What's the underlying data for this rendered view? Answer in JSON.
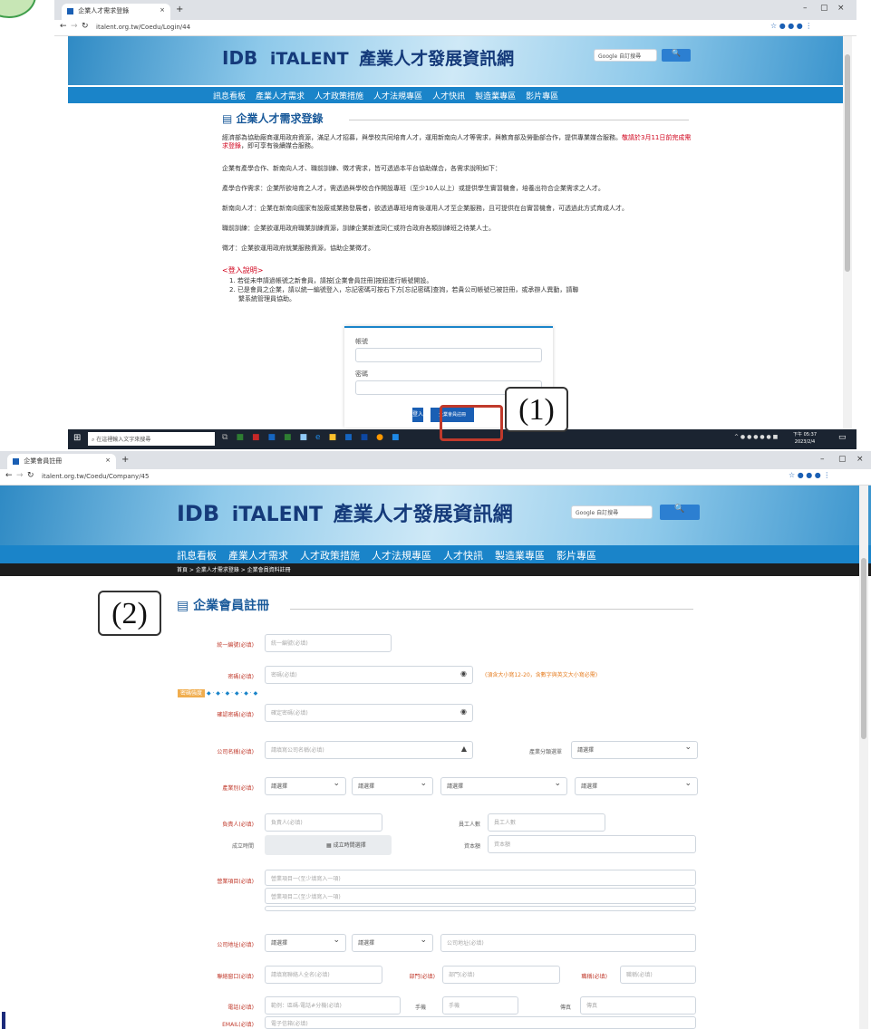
{
  "browser1": {
    "tab_title": "企業人才需求登錄",
    "url": "italent.org.tw/Coedu/Login/44"
  },
  "browser2": {
    "tab_title": "企業會員註冊",
    "url": "italent.org.tw/Coedu/Company/45"
  },
  "site": {
    "brand": "iTALENT",
    "title": "產業人才發展資訊網",
    "search_placeholder": "Google 自訂搜尋",
    "nav": [
      "訊息看板",
      "產業人才需求",
      "人才政策措施",
      "人才法規專區",
      "人才快訊",
      "製造業專區",
      "影片專區"
    ],
    "breadcrumb": "首頁 > 企業人才需求登錄 > 企業會員資料註冊"
  },
  "login_page": {
    "heading": "企業人才需求登錄",
    "paragraphs": [
      "經濟部為協助廠商運用政府資源，滿足人才招募，與學校共同培育人才，運用新南向人才等需求，與教育部及勞動部合作，提供專業媒合服務。",
      "敬請於3月11日前完成需求登錄",
      "，即可享有後續媒合服務。",
      "企業有產學合作、新南向人才、職前訓練、徵才需求，皆可透過本平台協助媒合，各需求說明如下：",
      "產學合作需求：企業所欲培育之人才，需透過與學校合作開設專班（至少10人以上）或提供學生實習機會，培養出符合企業需求之人才。",
      "新南向人才：企業在新南向國家有設廠或業務發展者，欲透過專班培育後運用人才至企業服務，且可提供在台實習機會，可透過此方式育成人才。",
      "職前訓練：企業欲運用政府職業訓練資源，訓練企業新進同仁或符合政府各類訓練班之待業人士。",
      "徵才：企業欲運用政府就業服務資源，協助企業徵才。"
    ],
    "login_note_title": "<登入說明>",
    "login_notes": [
      "1. 若從未申請過帳號之新會員，請按[企業會員註冊]按鈕進行帳號開設。",
      "2. 已是會員之企業，請以統一編號登入，忘記密碼可按右下方[忘記密碼]查詢，若貴公司帳號已被註冊，或承辦人異動，請聯",
      "繫系統管理員協助。"
    ],
    "account_label": "帳號",
    "password_label": "密碼",
    "login_button": "登入",
    "register_button": "企業會員註冊"
  },
  "register_page": {
    "heading": "企業會員註冊",
    "fields": {
      "tax_id": {
        "label": "統一編號(必填)",
        "placeholder": "統一編號(必填)"
      },
      "password": {
        "label": "密碼(必填)",
        "placeholder": "密碼(必填)",
        "hint": "(須含大小寫12-20，含數字與英文大小寫必需)"
      },
      "confirm_password": {
        "label": "確認密碼(必填)",
        "placeholder": "確定密碼(必填)"
      },
      "company_name": {
        "label": "公司名稱(必填)",
        "placeholder": "請填寫公司名稱(必填)"
      },
      "industry": {
        "label": "產業別(必填)"
      },
      "owner": {
        "label": "負責人(必填)",
        "placeholder": "負責人(必填)"
      },
      "employees": {
        "label": "員工人數",
        "placeholder": "員工人數"
      },
      "founded": {
        "label": "成立時間",
        "button": "成立時間選擇"
      },
      "capital": {
        "label": "資本額",
        "placeholder": "資本額"
      },
      "business": {
        "label": "營業項目(必填)",
        "placeholder1": "營業項目一(至少填寫入一項)",
        "placeholder2": "營業項目二(至少填寫入一項)"
      },
      "address": {
        "label": "公司地址(必填)",
        "placeholder": "公司地址(必填)"
      },
      "contact": {
        "label": "聯絡窗口(必填)",
        "placeholder": "請填寫聯絡人全名(必填)"
      },
      "department": {
        "label": "部門(必填)",
        "placeholder": "部門(必填)"
      },
      "title": {
        "label": "職稱(必填)",
        "placeholder": "職稱(必填)"
      },
      "phone": {
        "label": "電話(必填)",
        "placeholder": "範例：區碼-電話#分機(必填)"
      },
      "mobile": {
        "label": "手機",
        "placeholder": "手機"
      },
      "fax": {
        "label": "傳真",
        "placeholder": "傳真"
      },
      "email": {
        "label": "EMAIL(必填)",
        "placeholder": "電子信箱(必填)"
      }
    },
    "select_default": "請選擇",
    "select_label_side": "產業分類選單",
    "strength_label": "密碼強度"
  },
  "taskbar": {
    "search_placeholder": "在這裡輸入文字來搜尋",
    "time": "下午 05:37",
    "date": "2023/2/4"
  },
  "annotations": {
    "step1": "(1)",
    "step2": "(2)"
  },
  "colors": {
    "nav_blue": "#1a84c9",
    "heading_blue": "#1a5a9a",
    "required_red": "#c0392b",
    "highlight": "#c0392b"
  }
}
